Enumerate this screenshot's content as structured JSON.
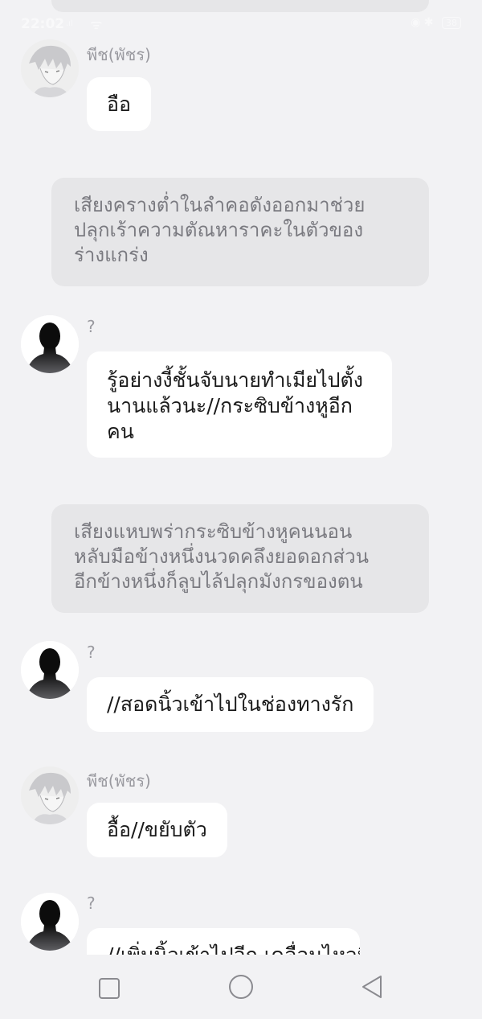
{
  "status_bar": {
    "time": "22:02",
    "network": ".ıl",
    "wifi": "ᯤ",
    "right_icons": "◉ ✱",
    "battery": "38"
  },
  "messages": [
    {
      "kind": "chat",
      "sender": "พีช(พัชร)",
      "avatar": "anime-avatar",
      "lines": [
        "อือ"
      ]
    },
    {
      "kind": "narration",
      "lines": [
        "เสียงครางต่ำในลำคอดังออกมาช่วย",
        "ปลุกเร้าความตัณหาราคะในตัวของ",
        "ร่างแกร่ง"
      ]
    },
    {
      "kind": "chat",
      "sender": "?",
      "avatar": "silhouette-avatar",
      "lines": [
        "รู้อย่างงี้ชั้นจับนายทำเมียไปตั้ง",
        "นานแล้วนะ//กระซิบข้างหูอีก",
        "คน"
      ]
    },
    {
      "kind": "narration",
      "lines": [
        "เสียงแหบพร่ากระซิบข้างหูคนนอน",
        "หลับมือข้างหนึ่งนวดคลึงยอดอกส่วน",
        "อีกข้างหนึ่งก็ลูบไล้ปลุกมังกรของตน"
      ]
    },
    {
      "kind": "chat",
      "sender": "?",
      "avatar": "silhouette-avatar",
      "lines": [
        "//สอดนิ้วเข้าไปในช่องทางรัก"
      ]
    },
    {
      "kind": "chat",
      "sender": "พีช(พัชร)",
      "avatar": "anime-avatar",
      "lines": [
        "อื้อ//ขยับตัว"
      ]
    },
    {
      "kind": "chat",
      "sender": "?",
      "avatar": "silhouette-avatar",
      "lines": [
        "//เพิ่มนิ้วเข้าไปอีก เคลื่อนไหวนิ้ว"
      ]
    }
  ],
  "nav": {
    "recent_icon": "square-recent-apps-icon",
    "home_icon": "circle-home-icon",
    "back_icon": "triangle-back-icon"
  },
  "colors": {
    "background": "#f2f2f4",
    "bubble": "#ffffff",
    "narration": "#e6e6e8",
    "narration_text": "#7a7a80",
    "sender_name": "#9a9aa0"
  }
}
